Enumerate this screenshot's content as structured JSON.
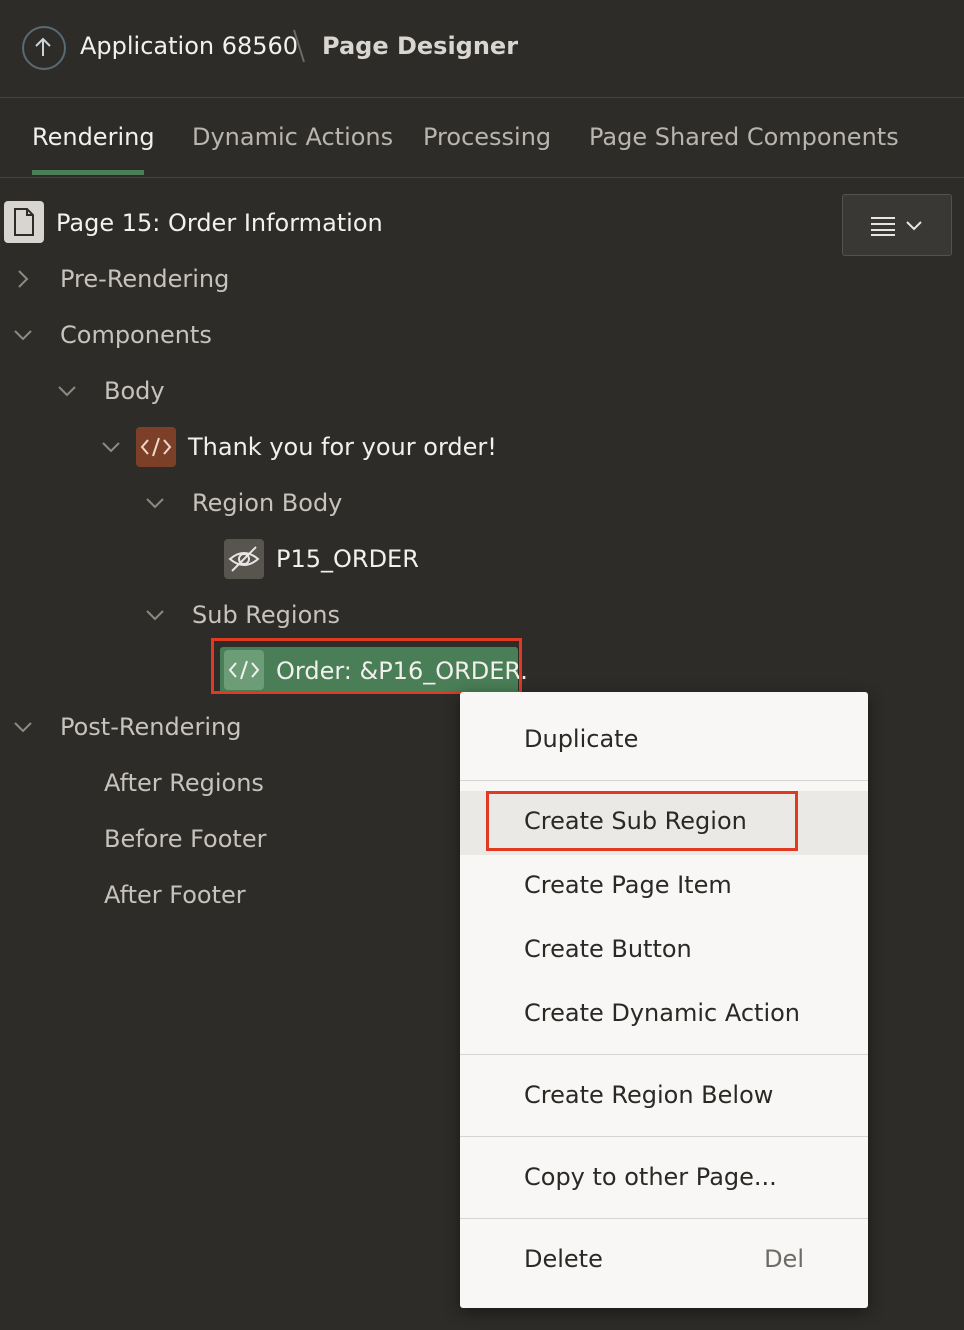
{
  "header": {
    "app_title": "Application 68560",
    "separator": "\\",
    "page_designer": "Page Designer"
  },
  "tabs": [
    {
      "label": "Rendering",
      "active": true
    },
    {
      "label": "Dynamic Actions"
    },
    {
      "label": "Processing"
    },
    {
      "label": "Page Shared Components"
    }
  ],
  "tree": {
    "page_title": "Page 15: Order Information",
    "pre_rendering": "Pre-Rendering",
    "components": "Components",
    "body": "Body",
    "region": "Thank you for your order!",
    "region_body": "Region Body",
    "item": "P15_ORDER",
    "sub_regions": "Sub Regions",
    "selected_region": "Order: &P16_ORDER.",
    "post_rendering": "Post-Rendering",
    "after_regions": "After Regions",
    "before_footer": "Before Footer",
    "after_footer": "After Footer"
  },
  "context_menu": {
    "duplicate": "Duplicate",
    "create_sub_region": "Create Sub Region",
    "create_page_item": "Create Page Item",
    "create_button": "Create Button",
    "create_dynamic_action": "Create Dynamic Action",
    "create_region_below": "Create Region Below",
    "copy_to_other_page": "Copy to other Page...",
    "delete": "Delete",
    "delete_shortcut": "Del"
  },
  "colors": {
    "background": "#2e2c29",
    "selected": "#4a7e56",
    "region_icon": "#7b4027",
    "highlight": "#e03a23"
  }
}
